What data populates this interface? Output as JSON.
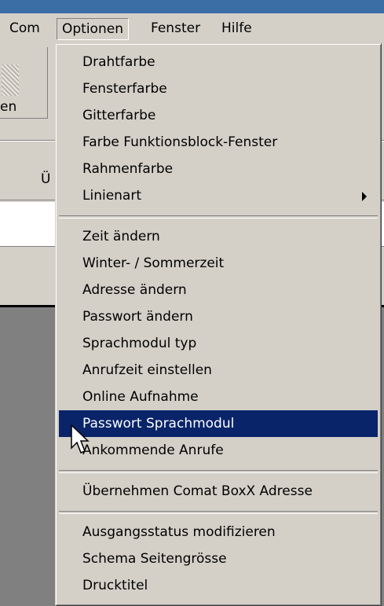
{
  "menubar": {
    "items": [
      "Com",
      "Optionen",
      "Fenster",
      "Hilfe"
    ]
  },
  "toolbar": {
    "partial_label": "en"
  },
  "panel": {
    "tab_partial": "Ü"
  },
  "menu": {
    "group1": [
      "Drahtfarbe",
      "Fensterfarbe",
      "Gitterfarbe",
      "Farbe Funktionsblock-Fenster",
      "Rahmenfarbe",
      "Linienart"
    ],
    "group2": [
      "Zeit ändern",
      "Winter- / Sommerzeit",
      "Adresse ändern",
      "Passwort ändern",
      "Sprachmodul typ",
      "Anrufzeit einstellen",
      "Online Aufnahme",
      "Passwort Sprachmodul",
      "Ankommende Anrufe"
    ],
    "group3": [
      "Übernehmen Comat BoxX Adresse"
    ],
    "group4": [
      "Ausgangsstatus modifizieren",
      "Schema Seitengrösse",
      "Drucktitel"
    ]
  },
  "colors": {
    "selection": "#0a246a",
    "face": "#d4d0c8",
    "title": "#3a6ea5"
  }
}
